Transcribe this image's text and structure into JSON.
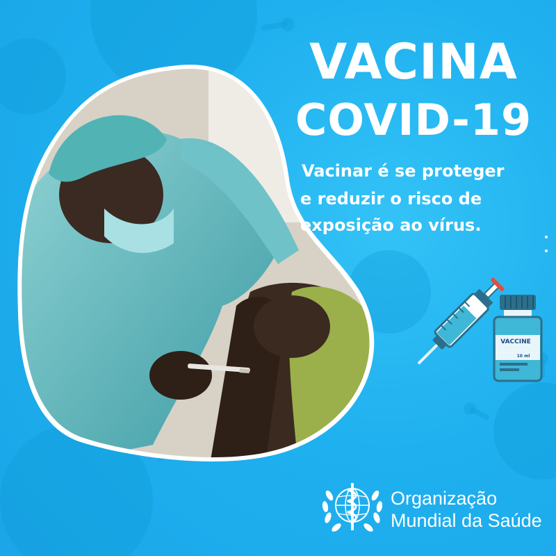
{
  "poster": {
    "title_line_1": "VACINA",
    "title_line_2": "COVID-19",
    "tagline_lines": [
      "Vacinar é se proteger",
      "e reduzir o risco de",
      "exposição ao vírus."
    ]
  },
  "illustration": {
    "vial_label": "VACCINE",
    "vial_volume": "10 ml"
  },
  "organization": {
    "name_line_1": "Organização",
    "name_line_2": "Mundial da Saúde"
  },
  "colors": {
    "background": "#1fb0ef",
    "text": "#ffffff",
    "syringe_body": "#3fb7d6",
    "syringe_accent": "#e84b3c",
    "vial_cap": "#2c6f8c"
  },
  "icons": [
    "virus-background-icon",
    "syringe-icon",
    "vaccine-vial-icon",
    "who-emblem-icon"
  ]
}
